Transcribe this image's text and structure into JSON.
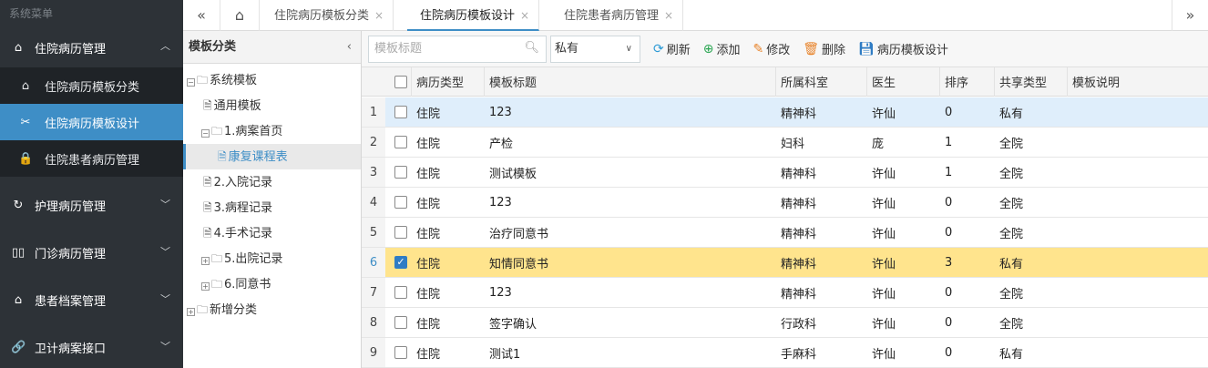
{
  "sidebar": {
    "title": "系统菜单",
    "groups": [
      {
        "label": "住院病历管理",
        "icon": "home-icon",
        "glyph": "⌂",
        "expanded": true,
        "items": [
          {
            "label": "住院病历模板分类",
            "glyph": "⌂"
          },
          {
            "label": "住院病历模板设计",
            "glyph": "✂"
          },
          {
            "label": "住院患者病历管理",
            "glyph": "🔒"
          }
        ]
      },
      {
        "label": "护理病历管理",
        "glyph": "↻"
      },
      {
        "label": "门诊病历管理",
        "glyph": "▯▯"
      },
      {
        "label": "患者档案管理",
        "glyph": "⌂"
      },
      {
        "label": "卫计病案接口",
        "glyph": "🔗"
      }
    ]
  },
  "tabs": {
    "items": [
      {
        "label": "住院病历模板分类",
        "close": "×"
      },
      {
        "label": "住院病历模板设计",
        "close": "×",
        "active": true
      },
      {
        "label": "住院患者病历管理",
        "close": "×"
      }
    ],
    "prev_glyph": "«",
    "home_glyph": "⌂",
    "next_glyph": "»"
  },
  "tree": {
    "title": "模板分类",
    "collapse_glyph": "‹",
    "nodes": [
      {
        "label": "系统模板"
      },
      {
        "label": "通用模板"
      },
      {
        "label": "1.病案首页"
      },
      {
        "label": "康复课程表"
      },
      {
        "label": "2.入院记录"
      },
      {
        "label": "3.病程记录"
      },
      {
        "label": "4.手术记录"
      },
      {
        "label": "5.出院记录"
      },
      {
        "label": "6.同意书"
      },
      {
        "label": "新增分类"
      }
    ]
  },
  "toolbar": {
    "search_placeholder": "模板标题",
    "share_select": "私有",
    "refresh": "刷新",
    "add": "添加",
    "edit": "修改",
    "delete": "删除",
    "design": "病历模板设计"
  },
  "grid": {
    "columns": [
      "病历类型",
      "模板标题",
      "所属科室",
      "医生",
      "排序",
      "共享类型",
      "模板说明"
    ],
    "rows": [
      {
        "num": "1",
        "type": "住院",
        "title": "123",
        "dept": "精神科",
        "doctor": "许仙",
        "order": "0",
        "share": "私有",
        "desc": ""
      },
      {
        "num": "2",
        "type": "住院",
        "title": "产检",
        "dept": "妇科",
        "doctor": "庞",
        "order": "1",
        "share": "全院",
        "desc": ""
      },
      {
        "num": "3",
        "type": "住院",
        "title": "测试模板",
        "dept": "精神科",
        "doctor": "许仙",
        "order": "1",
        "share": "全院",
        "desc": ""
      },
      {
        "num": "4",
        "type": "住院",
        "title": "123",
        "dept": "精神科",
        "doctor": "许仙",
        "order": "0",
        "share": "全院",
        "desc": ""
      },
      {
        "num": "5",
        "type": "住院",
        "title": "治疗同意书",
        "dept": "精神科",
        "doctor": "许仙",
        "order": "0",
        "share": "全院",
        "desc": ""
      },
      {
        "num": "6",
        "type": "住院",
        "title": "知情同意书",
        "dept": "精神科",
        "doctor": "许仙",
        "order": "3",
        "share": "私有",
        "desc": "",
        "checked": true
      },
      {
        "num": "7",
        "type": "住院",
        "title": "123",
        "dept": "精神科",
        "doctor": "许仙",
        "order": "0",
        "share": "全院",
        "desc": ""
      },
      {
        "num": "8",
        "type": "住院",
        "title": "签字确认",
        "dept": "行政科",
        "doctor": "许仙",
        "order": "0",
        "share": "全院",
        "desc": ""
      },
      {
        "num": "9",
        "type": "住院",
        "title": "测试1",
        "dept": "手麻科",
        "doctor": "许仙",
        "order": "0",
        "share": "私有",
        "desc": ""
      }
    ]
  },
  "colors": {
    "accent": "#3e8ec6",
    "sidebar_bg": "#2d3237",
    "selected_row": "#ffe48d",
    "hover_row": "#dfeefb"
  }
}
